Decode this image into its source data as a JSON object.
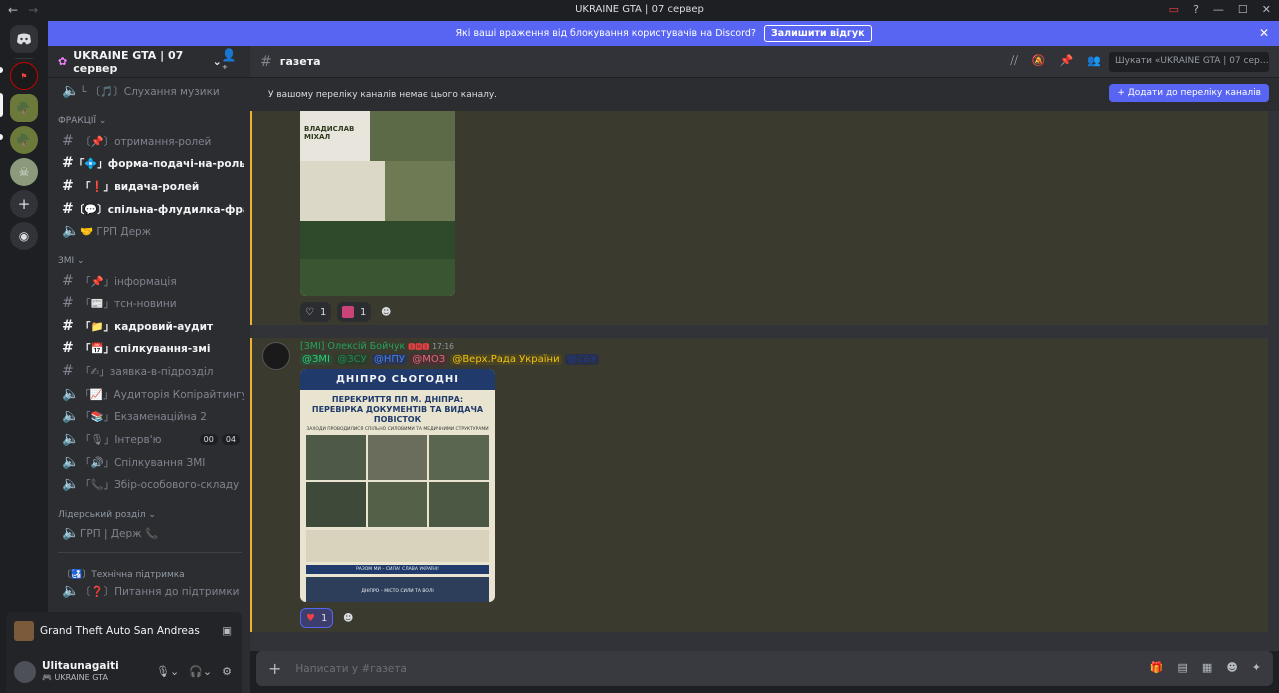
{
  "window": {
    "title": "UKRAINE GTA | 07 сервер",
    "back": "←",
    "forward": "→",
    "controls": [
      "▭",
      "?",
      "—",
      "☐",
      "✕"
    ]
  },
  "notice": {
    "text": "Які ваші враження від блокування користувачів на Discord?",
    "button": "Залишити відгук",
    "close": "✕"
  },
  "server": {
    "name": "UKRAINE GTA | 07 сервер",
    "chevron": "⌄"
  },
  "channels": {
    "music": "└ 〔🎵〕Слухання музики",
    "cat_factions": "ФРАКЦІЇ ⌄",
    "roles": "〔📌〕отримання-ролей",
    "form": "「💠」форма-подачі-на-роль",
    "issue": "「❗」видача-ролей",
    "flood": "〔💬〕спільна-флудилка-фракцій",
    "grp": "🤝 ГРП Держ",
    "cat_smi": "ЗМІ ⌄",
    "info": "「📌」інформація",
    "tsn": "「📰」тсн-новини",
    "audit": "「📁」кадровий-аудит",
    "comm": "「📅」спілкування-змі",
    "request": "「✍」заявка-в-підрозділ",
    "copy": "「📈」Аудиторія Копірайтингу",
    "exam": "「📚」Екзаменаційна 2",
    "interview": "「🎙」Інтерв'ю",
    "interview_badge1": "00",
    "interview_badge2": "04",
    "comm2": "「🔊」Спілкування ЗМІ",
    "gather": "「📞」Збір-особового-складу",
    "cat_leader": "Лідерський розділ ⌄",
    "grp2": "ГРП | Держ 📞",
    "support_cat": "〔🛃〕Технічна підтримка",
    "support": "〔❓〕Питання до підтримки"
  },
  "activity": {
    "game": "Grand Theft Auto San Andreas"
  },
  "user": {
    "name": "Ulitaunagaiti",
    "status": "UKRAINE GTA"
  },
  "header": {
    "channel": "газета",
    "search_placeholder": "Шукати «UKRAINE GTA | 07 сер…"
  },
  "channel_notice": {
    "text": "У вашому переліку каналів немає цього каналу.",
    "button": "+ Додати до переліку каналів"
  },
  "message1": {
    "poster_name": "ВЛАДИСЛАВ МІХАЛ",
    "r1_count": "1",
    "r2_count": "1"
  },
  "message2": {
    "role": "[ЗМІ]",
    "author": "Олексій Бойчук",
    "tag": "🆂🅼🆂",
    "time": "17:16",
    "m_smi": "@ЗМІ",
    "m_zsu": "@ЗСУ",
    "m_npu": "@НПУ",
    "m_moz": "@МОЗ",
    "m_rada": "@Верх.Рада України",
    "m_sbu": "@СБУ",
    "poster_title": "ДНІПРО СЬОГОДНІ",
    "poster_headline": "ПЕРЕКРИТТЯ ПП М. ДНІПРА: ПЕРЕВІРКА ДОКУМЕНТІВ ТА ВИДАЧА ПОВІСТОК",
    "poster_sub": "ЗАХОДИ ПРОВОДИЛИСЯ СПІЛЬНО СИЛОВИМИ ТА МЕДИЧНИМИ СТРУКТУРАМИ",
    "poster_slogan": "РАЗОМ МИ – СИЛА! СЛАВА УКРАЇНІ!",
    "poster_footer": "ДНІПРО – МІСТО СИЛИ ТА ВОЛІ",
    "r_count": "1"
  },
  "composer": {
    "placeholder": "Написати у #газета"
  }
}
